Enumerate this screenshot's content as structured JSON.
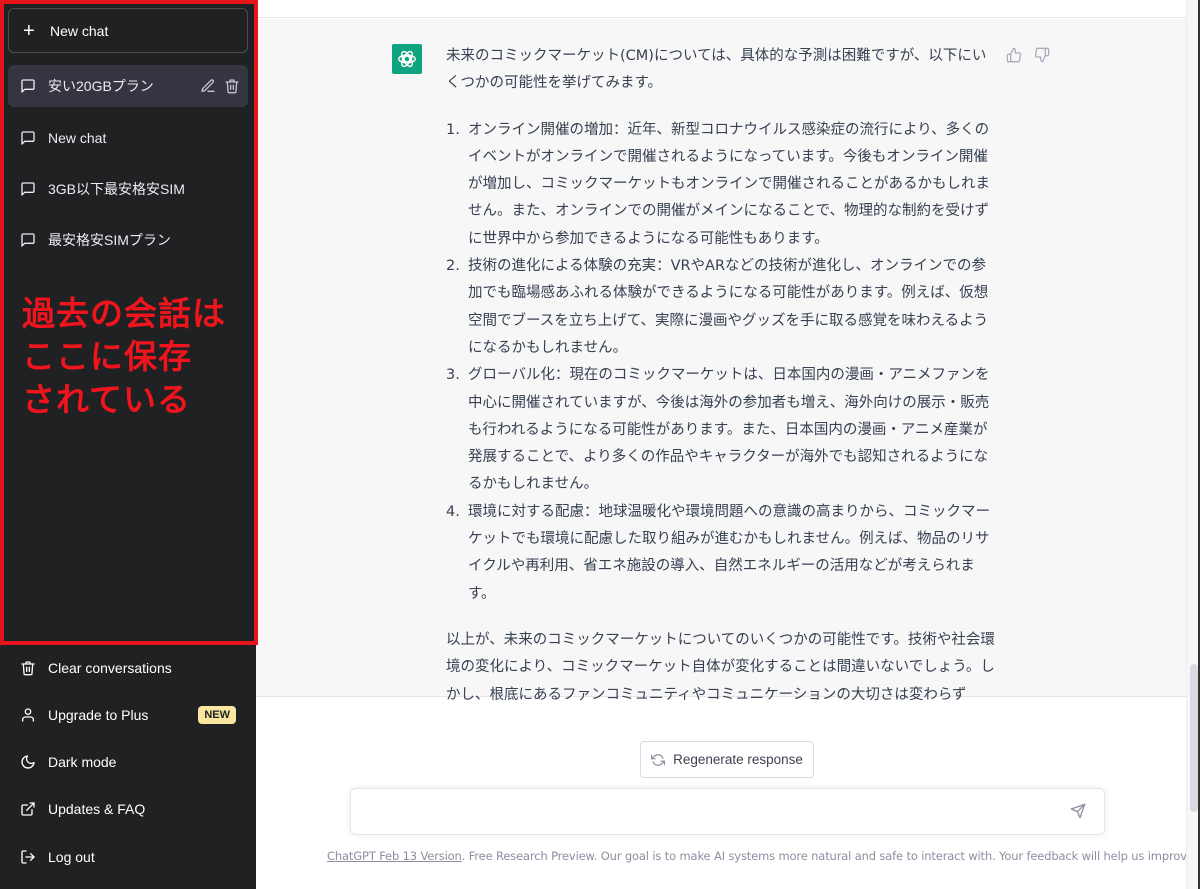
{
  "sidebar": {
    "new_chat_label": "New chat",
    "conversations": [
      {
        "label": "安い20GBプラン",
        "active": true
      },
      {
        "label": "New chat",
        "active": false
      },
      {
        "label": "3GB以下最安格安SIM",
        "active": false
      },
      {
        "label": "最安格安SIMプラン",
        "active": false
      }
    ],
    "bottom_items": [
      {
        "label": "Clear conversations",
        "icon": "trash-icon"
      },
      {
        "label": "Upgrade to Plus",
        "icon": "user-icon",
        "badge": "NEW"
      },
      {
        "label": "Dark mode",
        "icon": "moon-icon"
      },
      {
        "label": "Updates & FAQ",
        "icon": "external-link-icon"
      },
      {
        "label": "Log out",
        "icon": "logout-icon"
      }
    ]
  },
  "annotation": {
    "lines": [
      "過去の会話は",
      "ここに保存",
      "されている"
    ],
    "color": "#e8141b"
  },
  "message": {
    "intro": "未来のコミックマーケット(CM)については、具体的な予測は困難ですが、以下にいくつかの可能性を挙げてみます。",
    "items": [
      {
        "num": "1.",
        "text": "オンライン開催の増加：近年、新型コロナウイルス感染症の流行により、多くのイベントがオンラインで開催されるようになっています。今後もオンライン開催が増加し、コミックマーケットもオンラインで開催されることがあるかもしれません。また、オンラインでの開催がメインになることで、物理的な制約を受けずに世界中から参加できるようになる可能性もあります。"
      },
      {
        "num": "2.",
        "text": "技術の進化による体験の充実：VRやARなどの技術が進化し、オンラインでの参加でも臨場感あふれる体験ができるようになる可能性があります。例えば、仮想空間でブースを立ち上げて、実際に漫画やグッズを手に取る感覚を味わえるようになるかもしれません。"
      },
      {
        "num": "3.",
        "text": "グローバル化：現在のコミックマーケットは、日本国内の漫画・アニメファンを中心に開催されていますが、今後は海外の参加者も増え、海外向けの展示・販売も行われるようになる可能性があります。また、日本国内の漫画・アニメ産業が発展することで、より多くの作品やキャラクターが海外でも認知されるようになるかもしれません。"
      },
      {
        "num": "4.",
        "text": "環境に対する配慮：地球温暖化や環境問題への意識の高まりから、コミックマーケットでも環境に配慮した取り組みが進むかもしれません。例えば、物品のリサイクルや再利用、省エネ施設の導入、自然エネルギーの活用などが考えられます。"
      }
    ],
    "conclusion": "以上が、未来のコミックマーケットについてのいくつかの可能性です。技術や社会環境の変化により、コミックマーケット自体が変化することは間違いないでしょう。しかし、根底にあるファンコミュニティやコミュニケーションの大切さは変わらず"
  },
  "composer": {
    "regenerate_label": "Regenerate response",
    "input_value": "",
    "input_placeholder": ""
  },
  "footer": {
    "version_link": "ChatGPT Feb 13 Version",
    "text": ". Free Research Preview. Our goal is to make AI systems more natural and safe to interact with. Your feedback will help us improve."
  },
  "colors": {
    "sidebar_bg": "#202123",
    "brand_green": "#10a37f",
    "new_badge": "#fae69e"
  }
}
